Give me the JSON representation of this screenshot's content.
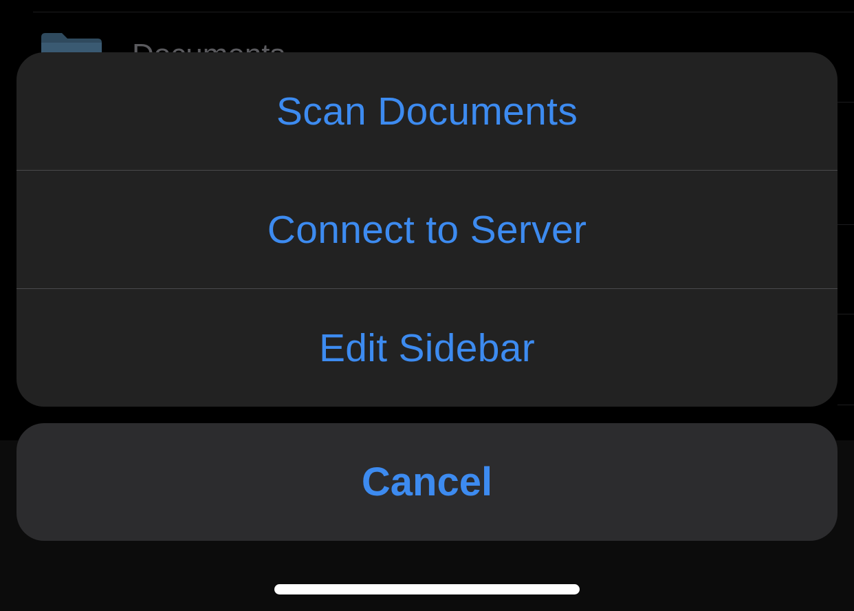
{
  "background": {
    "row_label": "Documents",
    "folder_icon": "folder-icon"
  },
  "action_sheet": {
    "items": [
      {
        "label": "Scan Documents"
      },
      {
        "label": "Connect to Server"
      },
      {
        "label": "Edit Sidebar"
      }
    ],
    "cancel_label": "Cancel"
  },
  "colors": {
    "accent": "#3d8bf0",
    "sheet_background": "#222222",
    "cancel_background": "#2c2c2e"
  }
}
